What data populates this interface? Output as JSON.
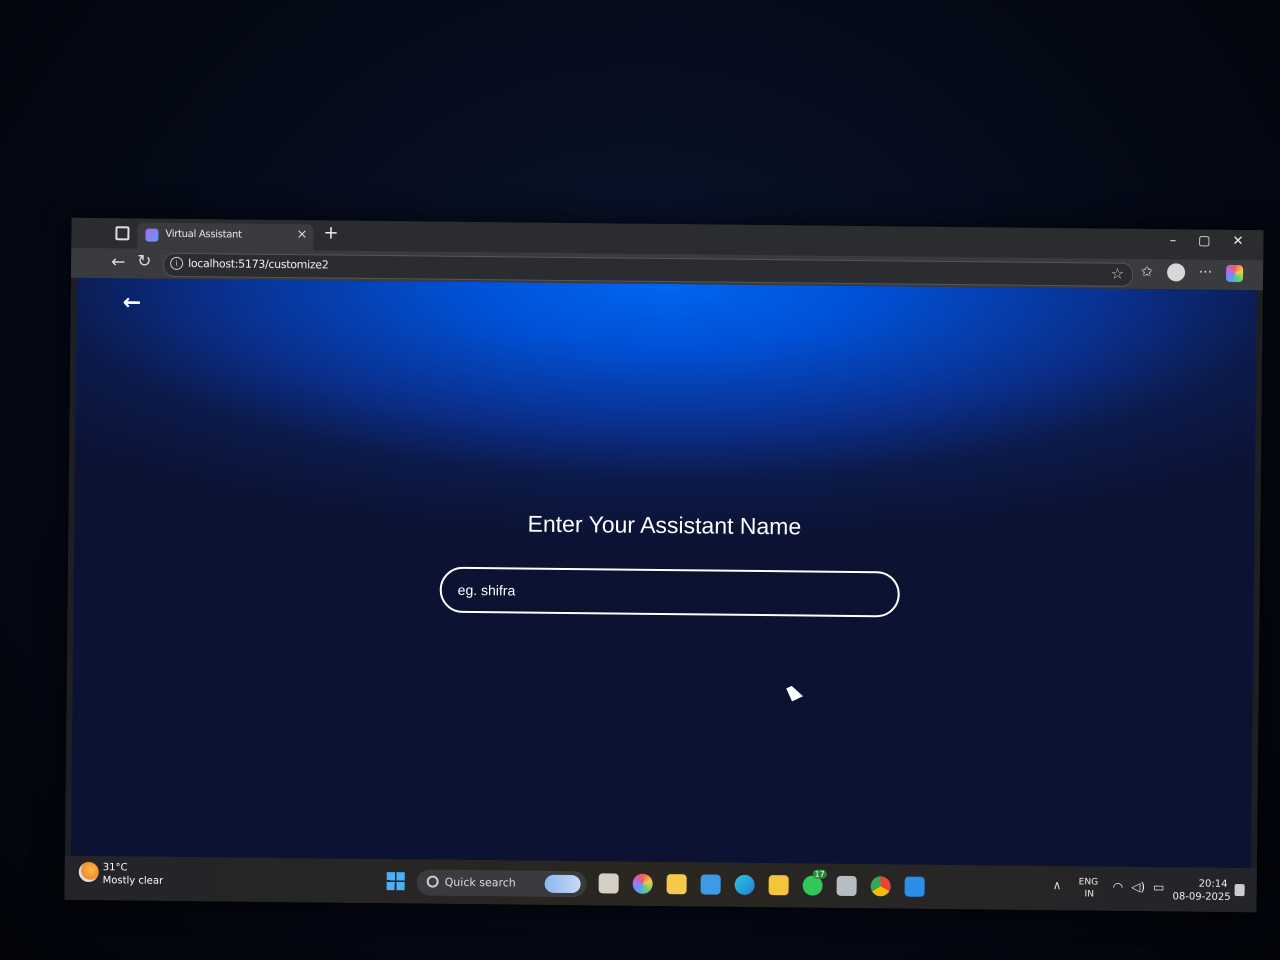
{
  "browser": {
    "tab_title": "Virtual Assistant",
    "tab_close": "×",
    "new_tab": "+",
    "url": "localhost:5173/customize2",
    "window_controls": [
      "–",
      "▢",
      "✕"
    ]
  },
  "page": {
    "back_icon": "←",
    "heading": "Enter Your Assistant Name",
    "name_input": {
      "placeholder": "eg. shifra",
      "value": ""
    }
  },
  "taskbar": {
    "weather_temp": "31°C",
    "weather_condition": "Mostly clear",
    "search_placeholder": "Quick search",
    "language_line1": "ENG",
    "language_line2": "IN",
    "time": "20:14",
    "date": "08-09-2025",
    "whatsapp_badge": "17"
  }
}
